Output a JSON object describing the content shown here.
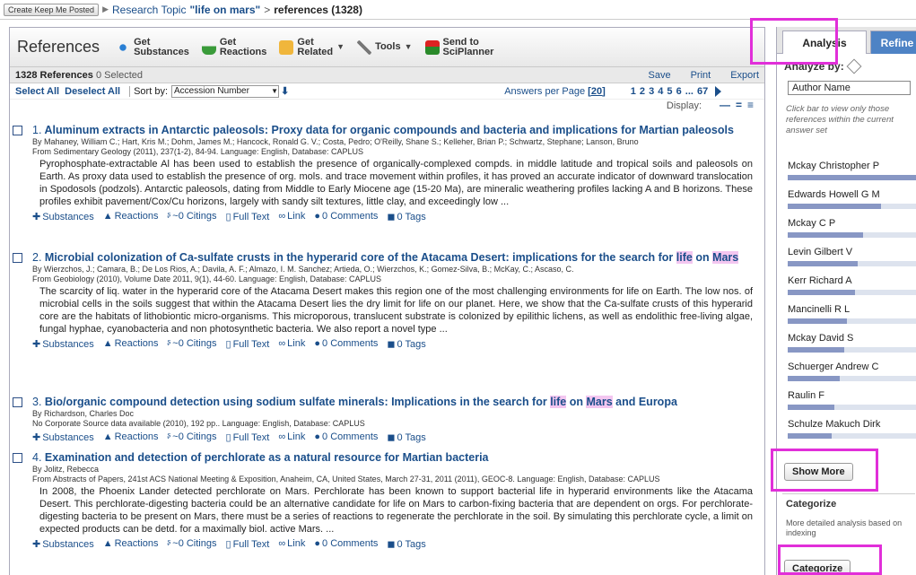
{
  "breadcrumb": {
    "button": "Create Keep Me Posted",
    "topic_prefix": "Research Topic",
    "topic": "\"life on mars\"",
    "sep": ">",
    "current": "references (1328)"
  },
  "toolbar": {
    "title": "References",
    "get_substances": [
      "Get",
      "Substances"
    ],
    "get_reactions": [
      "Get",
      "Reactions"
    ],
    "get_related": [
      "Get",
      "Related"
    ],
    "tools": "Tools",
    "send_to": [
      "Send to",
      "SciPlanner"
    ]
  },
  "countbar": {
    "count": "1328 References",
    "selected": "0 Selected",
    "save": "Save",
    "print": "Print",
    "export": "Export"
  },
  "sortbar": {
    "select_all": "Select All",
    "deselect_all": "Deselect All",
    "sort_label": "Sort by:",
    "sort_value": "Accession Number",
    "answers_label": "Answers per Page",
    "answers_value": "[20]",
    "pages": "1 2 3 4 5 6 ... 67"
  },
  "display_label": "Display:",
  "result_links": {
    "substances": "Substances",
    "reactions": "Reactions",
    "citings": "~0 Citings",
    "fulltext": "Full Text",
    "link": "Link",
    "comments": "0 Comments",
    "tags": "0 Tags"
  },
  "results": [
    {
      "num": "1.",
      "title": "Aluminum extracts in Antarctic paleosols: Proxy data for organic compounds and bacteria and implications for Martian paleosols",
      "authors": "By Mahaney, William C.; Hart, Kris M.; Dohm, James M.; Hancock, Ronald G. V.; Costa, Pedro; O'Reilly, Shane S.; Kelleher, Brian P.; Schwartz, Stephane; Lanson, Bruno",
      "source": "From Sedimentary Geology (2011), 237(1-2), 84-94. Language: English, Database: CAPLUS",
      "abstract": "Pyrophosphate-extractable Al has been used to establish the presence of organically-complexed compds. in middle latitude and tropical soils and paleosols on Earth. As proxy data used to establish the presence of org. mols. and trace movement within profiles, it has proved an accurate indicator of downward translocation in Spodosols (podzols). Antarctic paleosols, dating from Middle to Early Miocene age (15-20 Ma), are mineralic weathering profiles lacking A and B horizons. These profiles exhibit pavement/Cox/Cu horizons, largely with sandy silt textures, little clay, and exceedingly low ..."
    },
    {
      "num": "2.",
      "title_a": "Microbial colonization of Ca-sulfate crusts in the hyperarid core of the Atacama Desert: implications for the search for ",
      "title_hl1": "life",
      "title_b": " on ",
      "title_hl2": "Mars",
      "authors": "By Wierzchos, J.; Camara, B.; De Los Rios, A.; Davila, A. F.; Almazo, I. M. Sanchez; Artieda, O.; Wierzchos, K.; Gomez-Silva, B.; McKay, C.; Ascaso, C.",
      "source": "From Geobiology (2010), Volume Date 2011, 9(1), 44-60. Language: English, Database: CAPLUS",
      "abstract": "The scarcity of liq. water in the hyperarid core of the Atacama Desert makes this region one of the most challenging environments for life on Earth. The low nos. of microbial cells in the soils suggest that within the Atacama Desert lies the dry limit for life on our planet. Here, we show that the Ca-sulfate crusts of this hyperarid core are the habitats of lithobiontic micro-organisms. This microporous, translucent substrate is colonized by epilithic lichens, as well as endolithic free-living algae, fungal hyphae, cyanobacteria and non photosynthetic bacteria. We also report a novel type ..."
    },
    {
      "num": "3.",
      "title_a": "Bio/organic compound detection using sodium sulfate minerals: Implications in the search for ",
      "title_hl1": "life",
      "title_b": " on ",
      "title_hl2": "Mars",
      "title_c": " and Europa",
      "authors": "By Richardson, Charles Doc",
      "source": "No Corporate Source data available (2010), 192 pp.. Language: English, Database: CAPLUS"
    },
    {
      "num": "4.",
      "title": "Examination and detection of perchlorate as a natural resource for Martian bacteria",
      "authors": "By Jolitz, Rebecca",
      "source": "From Abstracts of Papers, 241st ACS National Meeting & Exposition, Anaheim, CA, United States, March 27-31, 2011 (2011), GEOC-8. Language: English, Database: CAPLUS",
      "abstract": "In 2008, the Phoenix Lander detected perchlorate on Mars. Perchlorate has been known to support bacterial life in hyperarid environments like the Atacama Desert. This perchlorate-digesting bacteria could be an alternative candidate for life on Mars to carbon-fixing bacteria that are dependent on orgs. For perchlorate-digesting bacteria to be present on Mars, there must be a series of reactions to regenerate the perchlorate in the soil. By simulating this perchlorate cycle, a limit on expected products can be detd. for a maximally biol. active Mars. ..."
    }
  ],
  "side": {
    "tab_analysis": "Analysis",
    "tab_refine": "Refine",
    "analyze_by": "Analyze by:",
    "analyze_value": "Author Name",
    "hint": "Click bar to view only those references within the current answer set",
    "authors": [
      {
        "name": "Mckay Christopher P",
        "pct": 1.0
      },
      {
        "name": "Edwards Howell G M",
        "pct": 0.72
      },
      {
        "name": "Mckay C P",
        "pct": 0.58
      },
      {
        "name": "Levin Gilbert V",
        "pct": 0.54
      },
      {
        "name": "Kerr Richard A",
        "pct": 0.52
      },
      {
        "name": "Mancinelli R L",
        "pct": 0.46
      },
      {
        "name": "Mckay David S",
        "pct": 0.44
      },
      {
        "name": "Schuerger Andrew C",
        "pct": 0.4
      },
      {
        "name": "Raulin F",
        "pct": 0.36
      },
      {
        "name": "Schulze Makuch Dirk",
        "pct": 0.34
      }
    ],
    "show_more": "Show More",
    "categorize_head": "Categorize",
    "categorize_desc": "More detailed analysis based on indexing",
    "categorize_btn": "Categorize"
  },
  "colors": {
    "link": "#1a4e8a",
    "highlight": "#f3c6f0",
    "annotation_box": "#e12fd9",
    "tab_refine": "#4e83c5"
  }
}
